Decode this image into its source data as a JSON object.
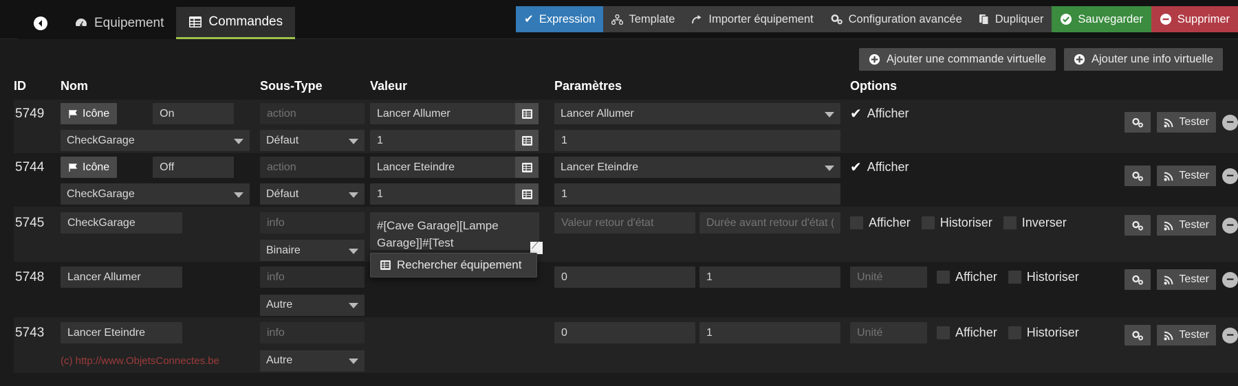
{
  "tabs": {
    "back_icon": "arrow-left-circle-icon",
    "items": [
      {
        "label": "Equipement",
        "icon": "dashboard-icon",
        "active": false
      },
      {
        "label": "Commandes",
        "icon": "table-icon",
        "active": true
      }
    ]
  },
  "toolbar": {
    "buttons": [
      {
        "label": "Expression",
        "icon": "check-icon",
        "style": "selected"
      },
      {
        "label": "Template",
        "icon": "sitemap-icon",
        "style": "default"
      },
      {
        "label": "Importer équipement",
        "icon": "share-icon",
        "style": "default"
      },
      {
        "label": "Configuration avancée",
        "icon": "cogs-icon",
        "style": "default"
      },
      {
        "label": "Dupliquer",
        "icon": "copy-icon",
        "style": "default"
      },
      {
        "label": "Sauvegarder",
        "icon": "check-circle-icon",
        "style": "green"
      },
      {
        "label": "Supprimer",
        "icon": "minus-circle-icon",
        "style": "red"
      }
    ]
  },
  "add_row": {
    "buttons": [
      {
        "label": "Ajouter une commande virtuelle",
        "icon": "plus-circle-icon"
      },
      {
        "label": "Ajouter une info virtuelle",
        "icon": "plus-circle-icon"
      }
    ]
  },
  "columns": {
    "id": "ID",
    "nom": "Nom",
    "sous_type": "Sous-Type",
    "valeur": "Valeur",
    "parametres": "Paramètres",
    "options": "Options"
  },
  "common": {
    "icone_label": "Icône",
    "tester_label": "Tester",
    "afficher_label": "Afficher",
    "historiser_label": "Historiser",
    "inverser_label": "Inverser",
    "unite_placeholder": "Unité",
    "action_placeholder": "action",
    "info_placeholder": "info",
    "valeur_retour_placeholder": "Valeur retour d'état",
    "duree_retour_placeholder": "Durée avant retour d'état (",
    "gear_icon": "cogs-icon",
    "tester_icon": "rss-icon",
    "delete_icon": "minus-circle-icon",
    "list_icon": "list-picker-icon",
    "flag_icon": "flag-icon"
  },
  "suggestion": {
    "items": [
      {
        "label": "Rechercher équipement",
        "icon": "table-icon"
      }
    ]
  },
  "rows": [
    {
      "id": "5749",
      "type": "action",
      "icone_label": "Icône",
      "name": "On",
      "parent": "CheckGarage",
      "subtype_placeholder": "action",
      "subtype_select": "Défaut",
      "value": "Lancer Allumer",
      "value2": "1",
      "param_select": "Lancer Allumer",
      "param_value": "1",
      "afficher": true,
      "afficher_label": "Afficher"
    },
    {
      "id": "5744",
      "type": "action",
      "icone_label": "Icône",
      "name": "Off",
      "parent": "CheckGarage",
      "subtype_placeholder": "action",
      "subtype_select": "Défaut",
      "value": "Lancer Eteindre",
      "value2": "1",
      "param_select": "Lancer Eteindre",
      "param_value": "1",
      "afficher": true,
      "afficher_label": "Afficher"
    },
    {
      "id": "5745",
      "type": "info",
      "name": "CheckGarage",
      "subtype_placeholder": "info",
      "subtype_select": "Binaire",
      "value": "#[Cave Garage][Lampe Garage]]#[Test",
      "param1_placeholder": "Valeur retour d'état",
      "param2_placeholder": "Durée avant retour d'état (",
      "afficher": false,
      "historiser": false,
      "inverser": false,
      "afficher_label": "Afficher",
      "historiser_label": "Historiser",
      "inverser_label": "Inverser",
      "has_suggestion": true
    },
    {
      "id": "5748",
      "type": "info",
      "name": "Lancer Allumer",
      "subtype_placeholder": "info",
      "subtype_select": "Autre",
      "param1": "0",
      "param2": "1",
      "unite_placeholder": "Unité",
      "afficher": false,
      "historiser": false,
      "afficher_label": "Afficher",
      "historiser_label": "Historiser"
    },
    {
      "id": "5743",
      "type": "info",
      "name": "Lancer Eteindre",
      "subtype_placeholder": "info",
      "subtype_select": "Autre",
      "param1": "0",
      "param2": "1",
      "unite_placeholder": "Unité",
      "afficher": false,
      "historiser": false,
      "afficher_label": "Afficher",
      "historiser_label": "Historiser"
    }
  ],
  "credit": "(c) http://www.ObjetsConnectes.be",
  "colors": {
    "accent_blue": "#337ab7",
    "green": "#3b8c3f",
    "red": "#b23c46",
    "tab_underline": "#9ec24a",
    "credit_red": "#9e3b3b"
  }
}
